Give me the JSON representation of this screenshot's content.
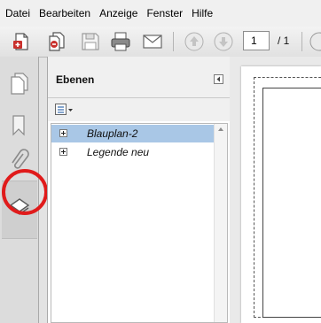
{
  "menu": [
    "Datei",
    "Bearbeiten",
    "Anzeige",
    "Fenster",
    "Hilfe"
  ],
  "toolbar": {
    "page_current": "1",
    "page_total": "/ 1",
    "icons": [
      "create-pdf-icon",
      "combine-files-icon",
      "save-icon",
      "print-icon",
      "email-icon",
      "previous-page-icon",
      "next-page-icon"
    ]
  },
  "rail": {
    "icons": [
      "pages-icon",
      "bookmarks-icon",
      "attachments-icon",
      "layers-icon"
    ],
    "active": "layers-icon"
  },
  "layers_panel": {
    "title": "Ebenen",
    "items": [
      {
        "label": "Blauplan-2",
        "selected": true
      },
      {
        "label": "Legende neu",
        "selected": false
      }
    ]
  },
  "colors": {
    "selection": "#a9c7e6",
    "highlight_ring": "#e01b1b"
  }
}
